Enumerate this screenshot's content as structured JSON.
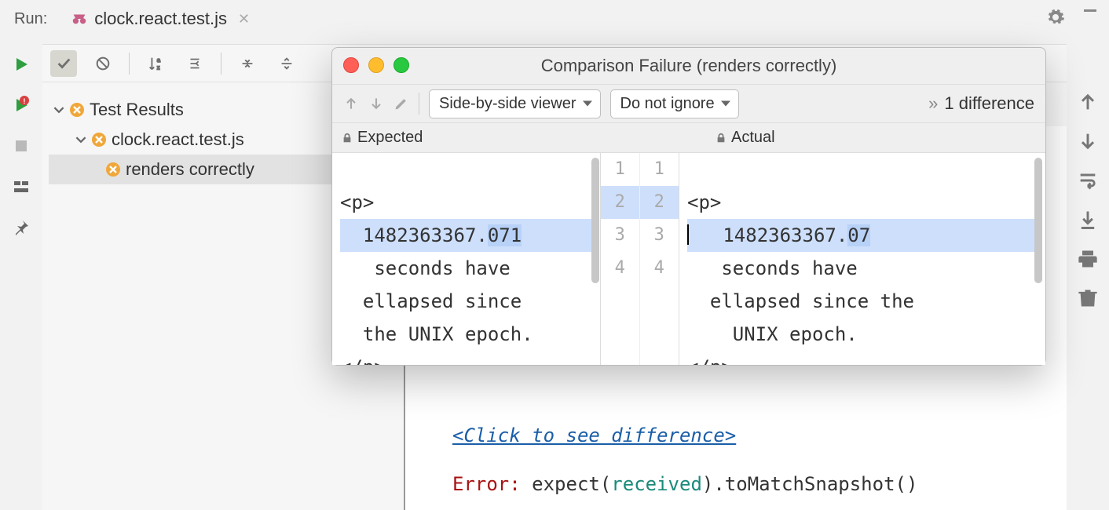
{
  "tabbar": {
    "run_label": "Run:",
    "tab_title": "clock.react.test.js"
  },
  "tree": {
    "root": "Test Results",
    "file": "clock.react.test.js",
    "test": "renders correctly"
  },
  "console": {
    "link": "<Click to see difference>",
    "error_prefix": "Error:",
    "expect_text_1": " expect(",
    "received": "received",
    "expect_text_2": ").toMatchSnapshot()"
  },
  "dialog": {
    "title": "Comparison Failure (renders correctly)",
    "viewer_mode": "Side-by-side viewer",
    "ignore_mode": "Do not ignore",
    "diff_count": "1 difference",
    "expected_label": "Expected",
    "actual_label": "Actual",
    "expected_lines": [
      "<p>",
      "  1482363367.071",
      "   seconds have",
      "  ellapsed since",
      "  the UNIX epoch.",
      "</p>"
    ],
    "actual_lines": [
      "<p>",
      "   1482363367.07",
      "   seconds have",
      "  ellapsed since the",
      "    UNIX epoch.",
      "</p>"
    ],
    "left_gutter": [
      "1",
      "2",
      "3",
      "",
      "",
      "4"
    ],
    "right_gutter": [
      "1",
      "2",
      "3",
      "",
      "",
      "4"
    ]
  }
}
